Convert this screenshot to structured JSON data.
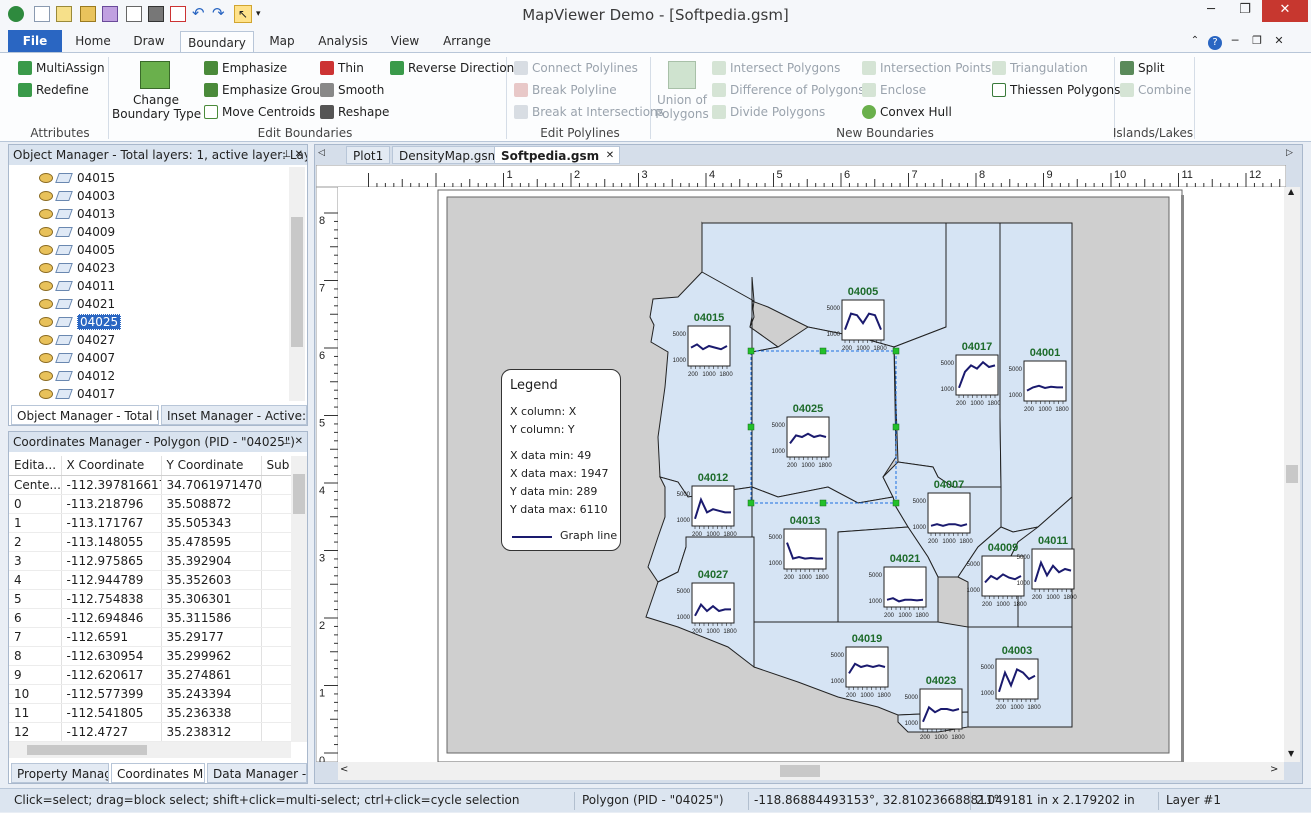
{
  "window": {
    "title": "MapViewer Demo - [Softpedia.gsm]"
  },
  "tabs": [
    "File",
    "Home",
    "Draw",
    "Boundary",
    "Map",
    "Analysis",
    "View",
    "Arrange"
  ],
  "active_tab": "Boundary",
  "ribbon": {
    "attributes": {
      "label": "Attributes",
      "multiassign": "MultiAssign",
      "redefine": "Redefine"
    },
    "edit_boundaries": {
      "label": "Edit Boundaries",
      "change_type": "Change",
      "change_type2": "Boundary Type",
      "emphasize": "Emphasize",
      "emphasize_group": "Emphasize Group",
      "move_centroids": "Move Centroids",
      "thin": "Thin",
      "smooth": "Smooth",
      "reshape": "Reshape",
      "reverse_direction": "Reverse Direction"
    },
    "edit_polylines": {
      "label": "Edit Polylines",
      "connect": "Connect Polylines",
      "break": "Break Polyline",
      "break_at": "Break at Intersections"
    },
    "new_boundaries": {
      "label": "New Boundaries",
      "union1": "Union of",
      "union2": "Polygons",
      "intersect": "Intersect Polygons",
      "difference": "Difference of Polygons",
      "divide": "Divide Polygons",
      "intersection_points": "Intersection Points",
      "enclose": "Enclose",
      "convex_hull": "Convex Hull",
      "triangulation": "Triangulation",
      "thiessen": "Thiessen Polygons"
    },
    "islands": {
      "label": "Islands/Lakes",
      "split": "Split",
      "combine": "Combine"
    }
  },
  "object_manager": {
    "title": "Object Manager - Total layers: 1, active layer: Lay...",
    "items": [
      "04015",
      "04003",
      "04013",
      "04009",
      "04005",
      "04023",
      "04011",
      "04021",
      "04025",
      "04027",
      "04007",
      "04012",
      "04017"
    ],
    "selected": "04025",
    "tabs": [
      "Object Manager - Total la...",
      "Inset Manager - Active: N..."
    ]
  },
  "coords_manager": {
    "title": "Coordinates Manager - Polygon (PID - \"04025\")",
    "headers": [
      "Edita...",
      "X Coordinate",
      "Y Coordinate",
      "Sub"
    ],
    "rows": [
      [
        "Cente...",
        "-112.3978166175",
        "34.706197147098"
      ],
      [
        "0",
        "-113.218796",
        "35.508872"
      ],
      [
        "1",
        "-113.171767",
        "35.505343"
      ],
      [
        "2",
        "-113.148055",
        "35.478595"
      ],
      [
        "3",
        "-112.975865",
        "35.392904"
      ],
      [
        "4",
        "-112.944789",
        "35.352603"
      ],
      [
        "5",
        "-112.754838",
        "35.306301"
      ],
      [
        "6",
        "-112.694846",
        "35.311586"
      ],
      [
        "7",
        "-112.6591",
        "35.29177"
      ],
      [
        "8",
        "-112.630954",
        "35.299962"
      ],
      [
        "9",
        "-112.620617",
        "35.274861"
      ],
      [
        "10",
        "-112.577399",
        "35.243394"
      ],
      [
        "11",
        "-112.541805",
        "35.236338"
      ],
      [
        "12",
        "-112.4727",
        "35.238312"
      ]
    ],
    "tabs": [
      "Property Manag...",
      "Coordinates Ma...",
      "Data Manager -..."
    ]
  },
  "doc_tabs": [
    "Plot1",
    "DensityMap.gsm",
    "Softpedia.gsm"
  ],
  "ruler": {
    "h": [
      "1",
      "2",
      "3",
      "4",
      "5",
      "6",
      "7",
      "8",
      "9",
      "10",
      "11",
      "12"
    ],
    "v": [
      "8",
      "7",
      "6",
      "5",
      "4",
      "3",
      "2",
      "1",
      "0"
    ]
  },
  "legend": {
    "title": "Legend",
    "lines": [
      "X column: X",
      "Y column: Y",
      "X data min:  49",
      "X data max:  1947",
      "Y data min:  289",
      "Y data max:  6110"
    ],
    "series": "Graph line"
  },
  "counties": [
    "04015",
    "04005",
    "04017",
    "04001",
    "04025",
    "04012",
    "04007",
    "04013",
    "04021",
    "04009",
    "04011",
    "04027",
    "04019",
    "04003",
    "04023"
  ],
  "mini_axes": {
    "y": [
      "5000",
      "1000"
    ],
    "x": [
      "200",
      "1000",
      "1800"
    ]
  },
  "status": {
    "hint": "Click=select; drag=block select; shift+click=multi-select; ctrl+click=cycle selection",
    "object": "Polygon (PID - \"04025\")",
    "position": "-118.86884493153°, 32.810236688811°",
    "size": "2.049181 in x 2.179202 in",
    "layer": "Layer #1"
  },
  "colors": {
    "accent": "#2a66c2",
    "county_fill": "#d6e4f4",
    "selection": "#1b6ee0",
    "handle": "#22c02a",
    "label": "#1d6b2a",
    "graph": "#1a1a6e"
  }
}
